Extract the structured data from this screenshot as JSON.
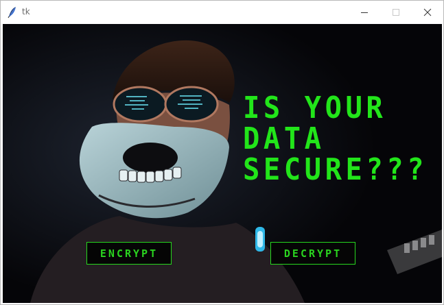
{
  "window": {
    "title": "tk"
  },
  "headline": {
    "line1": "IS YOUR",
    "line2": "DATA",
    "line3": "SECURE???"
  },
  "buttons": {
    "encrypt": "ENCRYPT",
    "decrypt": "DECRYPT"
  },
  "colors": {
    "accent": "#22e51a",
    "background": "#07070b"
  },
  "icons": {
    "app": "feather-icon",
    "minimize": "minimize-icon",
    "maximize": "maximize-icon",
    "close": "close-icon"
  }
}
